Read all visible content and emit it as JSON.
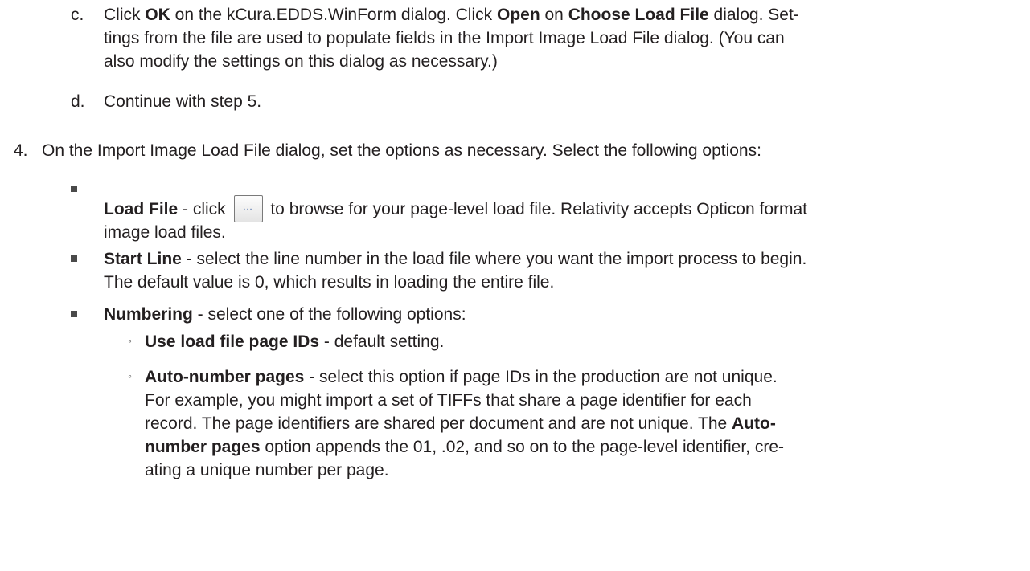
{
  "step3": {
    "c": {
      "marker": "c.",
      "t1": "Click ",
      "b1": "OK",
      "t2": " on the kCura.EDDS.WinForm dialog. Click ",
      "b2": "Open",
      "t3": " on ",
      "b3": "Choose Load File",
      "t4": " dialog. Set-",
      "line2": "tings from the file are used to populate fields in the Import Image Load File dialog. (You can",
      "line3": "also modify the settings on this dialog as necessary.)"
    },
    "d": {
      "marker": "d.",
      "text": "Continue with step 5."
    }
  },
  "step4": {
    "marker": "4.",
    "text": "On the Import Image Load File dialog, set the options as necessary. Select the following options:",
    "load_file": {
      "label": "Load File",
      "t1": " - click ",
      "button_label": "...",
      "t2": " to browse for your page-level load file. Relativity accepts Opticon format",
      "line2": "image load files."
    },
    "start_line": {
      "label": "Start Line",
      "t1": " - select the line number in the load file where you want the import process to begin.",
      "line2": "The default value is 0, which results in loading the entire file."
    },
    "numbering": {
      "label": "Numbering",
      "t1": " - select one of the following options:",
      "use_ids": {
        "label": "Use load file page IDs",
        "t1": " - default setting."
      },
      "auto": {
        "label": "Auto-number pages",
        "t1": " - select this option if page IDs in the production are not unique.",
        "line2": "For example, you might import a set of TIFFs that share a page identifier for each",
        "line3_t": "record. The page identifiers are shared per document and are not unique. The ",
        "line3_b": "Auto-",
        "line4_b": "number pages",
        "line4_t": " option appends the 01, .02, and so on to the page-level identifier, cre-",
        "line5": "ating a unique number per page."
      }
    }
  },
  "colors": {
    "text": "#231f20",
    "bullet": "#4a4a4a",
    "button_border": "#7a7a7a"
  }
}
